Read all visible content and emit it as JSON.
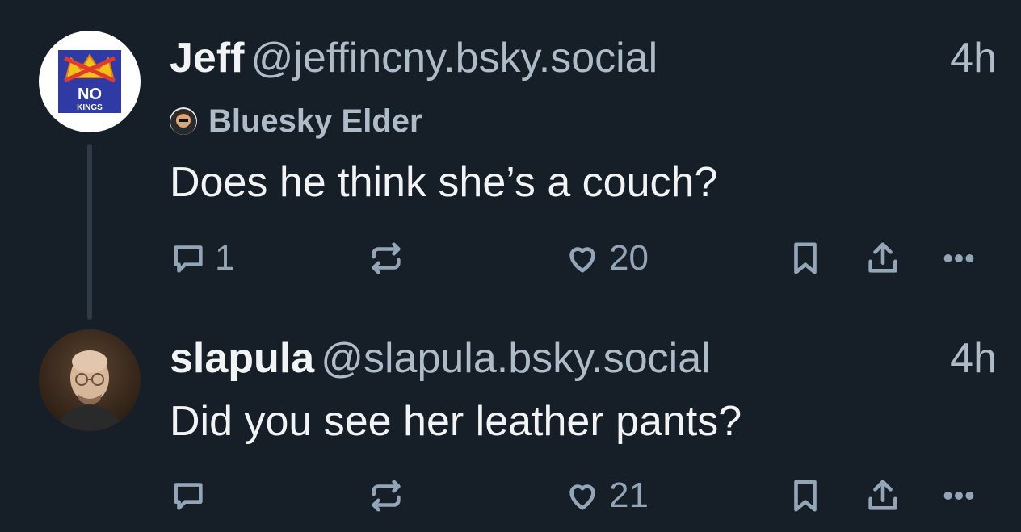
{
  "posts": [
    {
      "name": "Jeff",
      "handle": "@jeffincny.bsky.social",
      "time": "4h",
      "badge": "Bluesky Elder",
      "avatar_text_1": "NO",
      "avatar_text_2": "KINGS",
      "text": "Does he think she’s a couch?",
      "actions": {
        "reply_count": "1",
        "repost_count": "",
        "like_count": "20"
      }
    },
    {
      "name": "slapula",
      "handle": "@slapula.bsky.social",
      "time": "4h",
      "text": "Did you see her leather pants?",
      "actions": {
        "reply_count": "",
        "repost_count": "",
        "like_count": "21"
      }
    }
  ],
  "icons": {
    "reply": "speech-bubble-icon",
    "repost": "repost-arrows-icon",
    "like": "heart-icon",
    "bookmark": "bookmark-icon",
    "share": "share-upload-icon",
    "more": "ellipsis-icon"
  },
  "colors": {
    "background": "#161e27",
    "primary_text": "#f1f3f5",
    "secondary_text": "#aebbc9",
    "icon": "#93a5b7",
    "thread_line": "#2e3a47"
  }
}
